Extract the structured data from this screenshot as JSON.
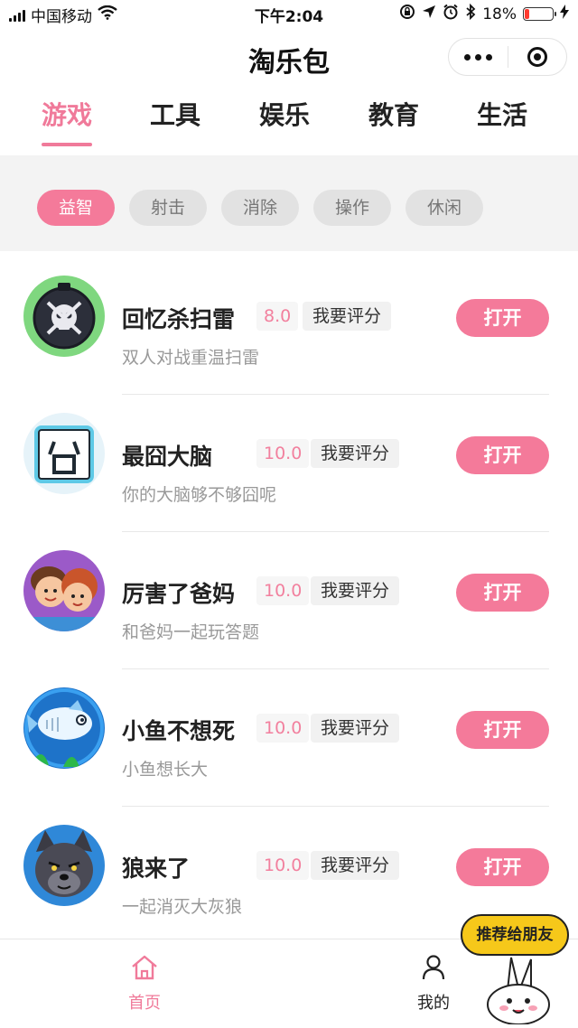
{
  "status_bar": {
    "carrier": "中国移动",
    "time": "下午2:04",
    "battery_percent": "18%",
    "battery_level": 0.18,
    "icons": [
      "signal-icon",
      "wifi-icon",
      "lock-rotation-icon",
      "location-icon",
      "alarm-icon",
      "bluetooth-icon",
      "battery-icon",
      "charging-icon"
    ]
  },
  "title_bar": {
    "title": "淘乐包",
    "more_icon": "more-dots-icon",
    "close_icon": "miniprogram-target-icon"
  },
  "tabs": [
    {
      "label": "游戏",
      "active": true
    },
    {
      "label": "工具",
      "active": false
    },
    {
      "label": "娱乐",
      "active": false
    },
    {
      "label": "教育",
      "active": false
    },
    {
      "label": "生活",
      "active": false
    }
  ],
  "chips": [
    {
      "label": "益智",
      "active": true
    },
    {
      "label": "射击",
      "active": false
    },
    {
      "label": "消除",
      "active": false
    },
    {
      "label": "操作",
      "active": false
    },
    {
      "label": "休闲",
      "active": false
    }
  ],
  "games": [
    {
      "name": "回忆杀扫雷",
      "score": "8.0",
      "rate_label": "我要评分",
      "desc": "双人对战重温扫雷",
      "open_label": "打开",
      "icon": "bomb-skull-icon"
    },
    {
      "name": "最囧大脑",
      "score": "10.0",
      "rate_label": "我要评分",
      "desc": "你的大脑够不够囧呢",
      "open_label": "打开",
      "icon": "jiong-character-icon"
    },
    {
      "name": "厉害了爸妈",
      "score": "10.0",
      "rate_label": "我要评分",
      "desc": "和爸妈一起玩答题",
      "open_label": "打开",
      "icon": "parents-cartoon-icon"
    },
    {
      "name": "小鱼不想死",
      "score": "10.0",
      "rate_label": "我要评分",
      "desc": "小鱼想长大",
      "open_label": "打开",
      "icon": "fish-icon"
    },
    {
      "name": "狼来了",
      "score": "10.0",
      "rate_label": "我要评分",
      "desc": "一起消灭大灰狼",
      "open_label": "打开",
      "icon": "wolf-icon"
    }
  ],
  "bottom_nav": [
    {
      "label": "首页",
      "icon": "home-icon",
      "active": true
    },
    {
      "label": "我的",
      "icon": "user-icon",
      "active": false
    }
  ],
  "recommend": {
    "label": "推荐给朋友"
  },
  "colors": {
    "accent": "#f47a9a",
    "chip_bg": "#e2e2e2",
    "section_bg": "#f3f3f3"
  }
}
